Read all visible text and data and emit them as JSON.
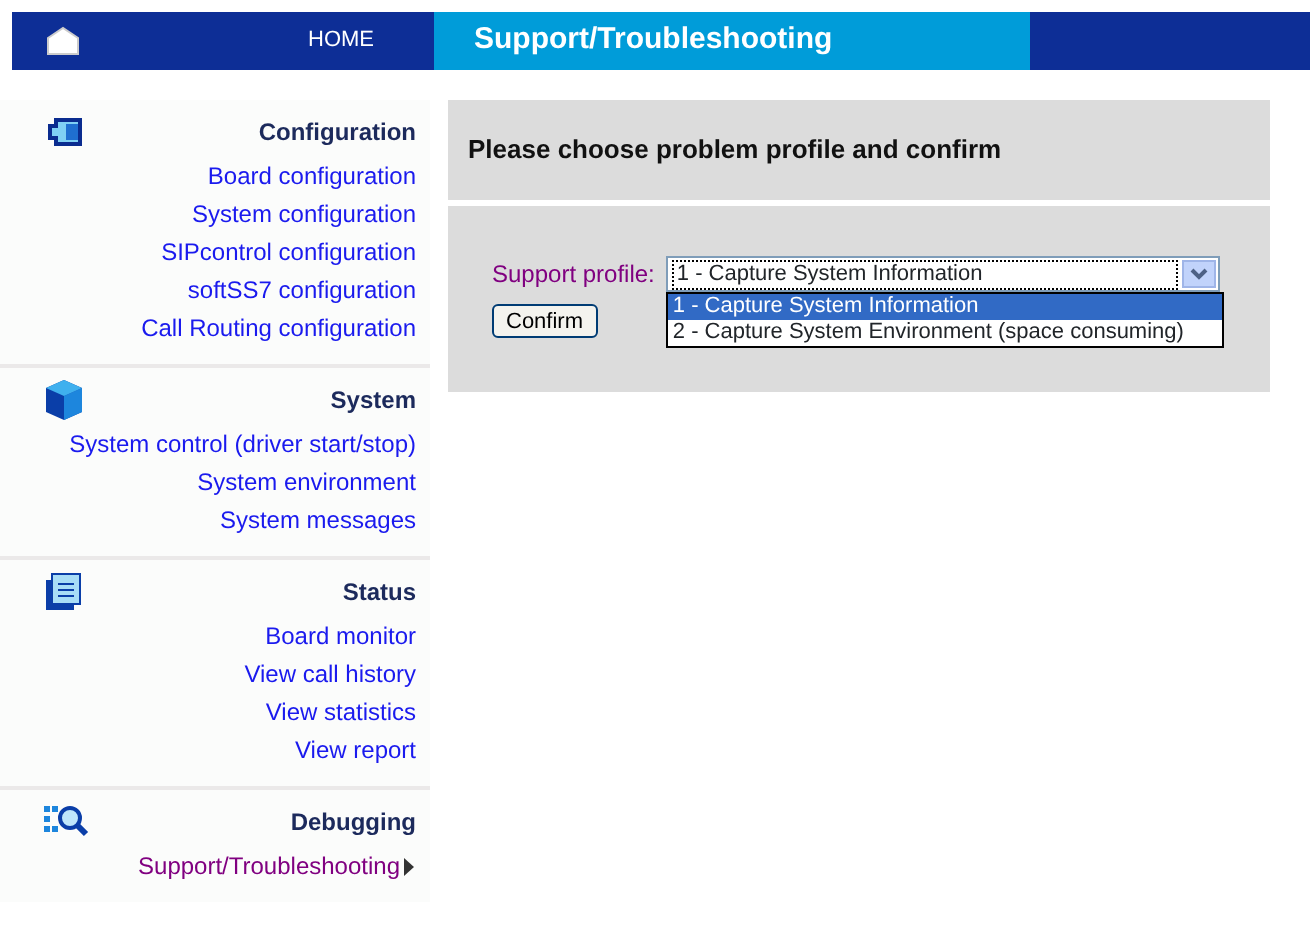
{
  "top_bar": {
    "home_label": "HOME",
    "page_title": "Support/Troubleshooting"
  },
  "sidebar": {
    "sections": [
      {
        "kind": "configuration",
        "title": "Configuration",
        "items": [
          {
            "label": "Board configuration",
            "selected": false
          },
          {
            "label": "System configuration",
            "selected": false
          },
          {
            "label": "SIPcontrol configuration",
            "selected": false
          },
          {
            "label": "softSS7 configuration",
            "selected": false
          },
          {
            "label": "Call Routing configuration",
            "selected": false
          }
        ]
      },
      {
        "kind": "system",
        "title": "System",
        "items": [
          {
            "label": "System control (driver start/stop)",
            "selected": false
          },
          {
            "label": "System environment",
            "selected": false
          },
          {
            "label": "System messages",
            "selected": false
          }
        ]
      },
      {
        "kind": "status",
        "title": "Status",
        "items": [
          {
            "label": "Board monitor",
            "selected": false
          },
          {
            "label": "View call history",
            "selected": false
          },
          {
            "label": "View statistics",
            "selected": false
          },
          {
            "label": "View report",
            "selected": false
          }
        ]
      },
      {
        "kind": "debugging",
        "title": "Debugging",
        "items": [
          {
            "label": "Support/Troubleshooting",
            "selected": true
          }
        ]
      }
    ]
  },
  "main": {
    "heading": "Please choose problem profile and confirm",
    "form": {
      "label": "Support profile:",
      "value": "1 - Capture System Information",
      "expanded": true,
      "options": [
        {
          "label": "1 - Capture System Information",
          "selected": true
        },
        {
          "label": "2 - Capture System Environment (space consuming)",
          "selected": false
        }
      ],
      "button": "Confirm"
    }
  }
}
